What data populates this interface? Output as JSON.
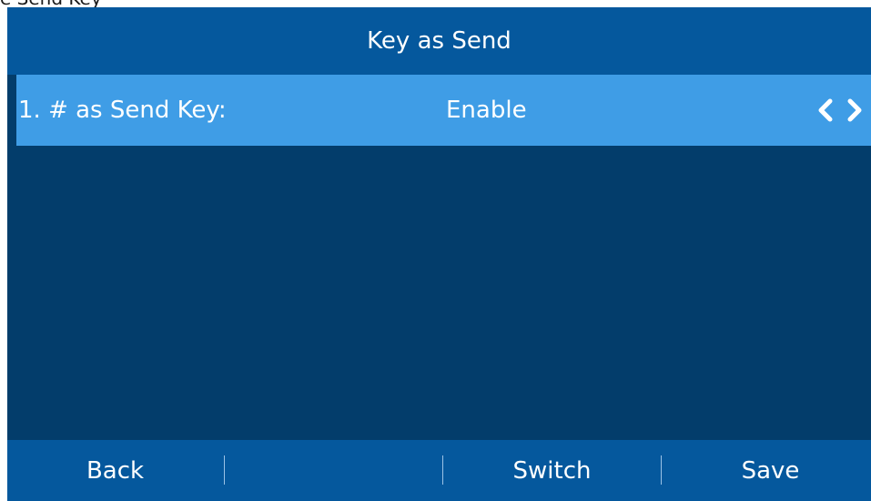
{
  "top_fragment": "e Send Key",
  "screen": {
    "title": "Key as Send"
  },
  "settings_list": {
    "items": [
      {
        "label": "1.  # as Send Key:",
        "value": "Enable"
      }
    ]
  },
  "softkeys": [
    {
      "label": "Back"
    },
    {
      "label": ""
    },
    {
      "label": "Switch"
    },
    {
      "label": "Save"
    }
  ],
  "icons": {
    "option_prev": "chevron-left-icon",
    "option_next": "chevron-right-icon"
  },
  "colors": {
    "title_bar": "#05589d",
    "screen_background": "#033d6b",
    "selected_row": "#3f9de6",
    "softkey_bar": "#05589d",
    "text": "#ffffff"
  }
}
